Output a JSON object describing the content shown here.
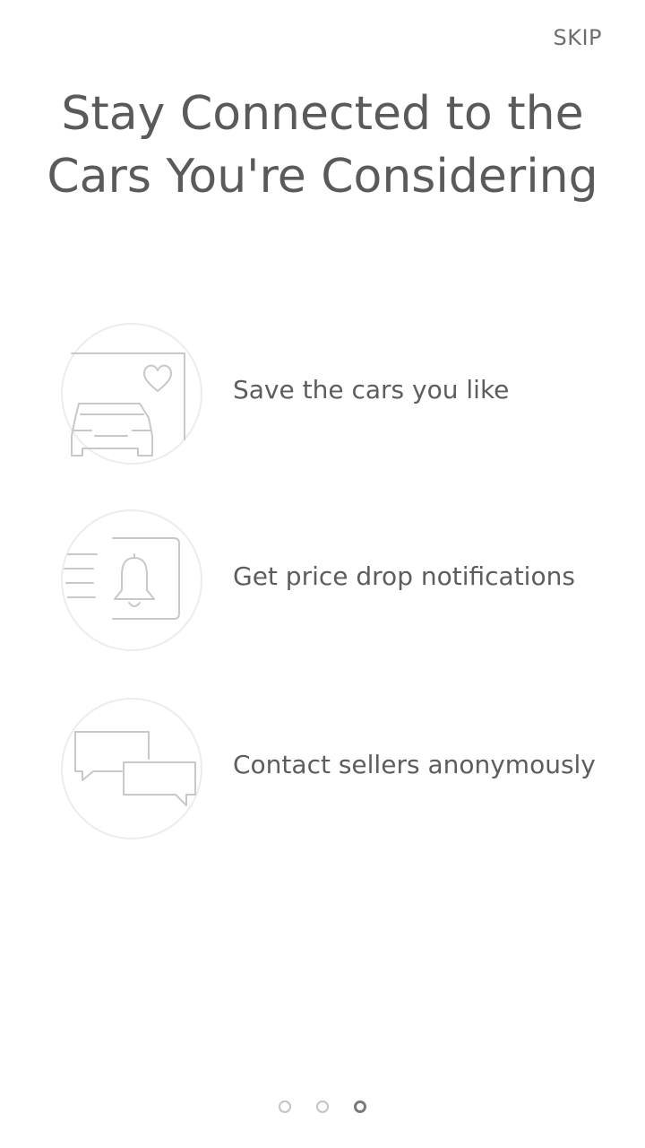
{
  "header": {
    "skip_label": "SKIP"
  },
  "title": {
    "line1": "Stay Connected to the",
    "line2": "Cars You're Considering"
  },
  "features": [
    {
      "label": "Save the cars you like",
      "icon": "car-heart-icon"
    },
    {
      "label": "Get price drop notifications",
      "icon": "bell-icon"
    },
    {
      "label": "Contact sellers anonymously",
      "icon": "chat-bubbles-icon"
    }
  ],
  "pagination": {
    "total": 3,
    "active_index": 2
  },
  "colors": {
    "text": "#5a5a5a",
    "line": "#d0d0d0",
    "dot_inactive": "#c4c4c4",
    "dot_active": "#7a7a7a"
  }
}
